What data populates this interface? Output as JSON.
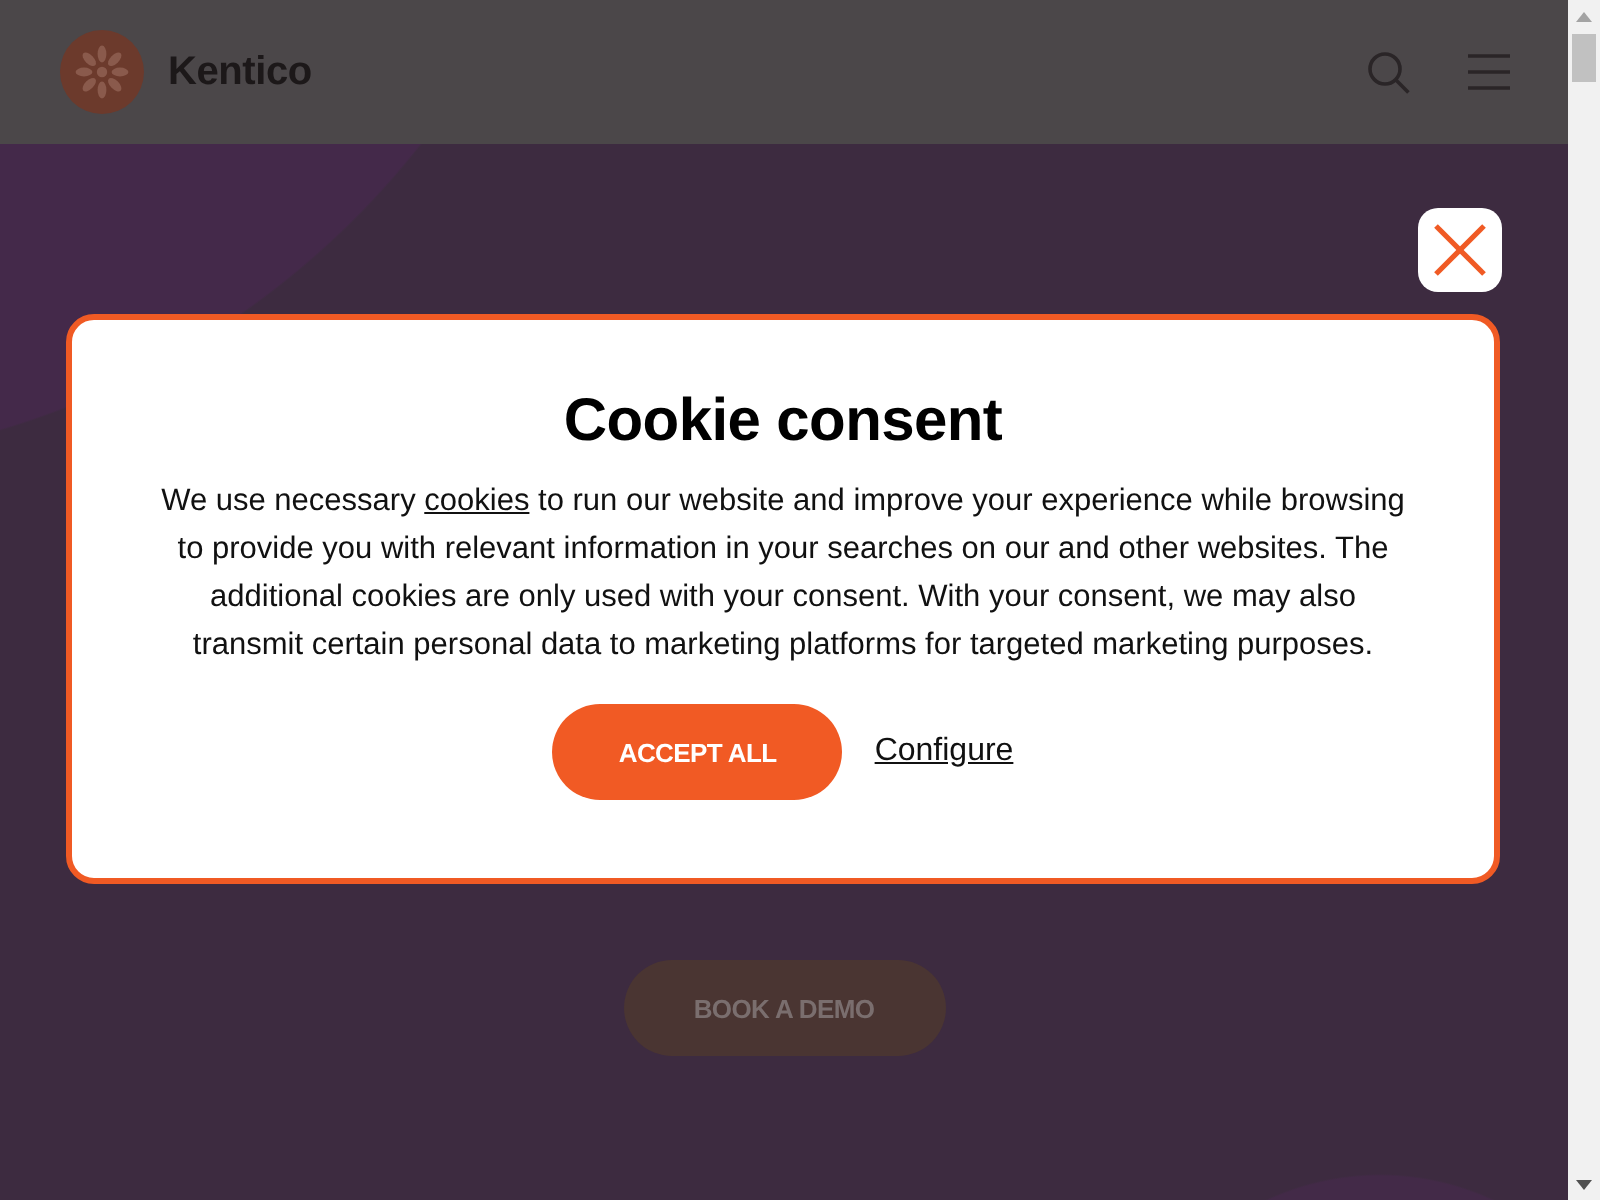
{
  "header": {
    "logo_text": "Kentico"
  },
  "hero": {
    "button": "BOOK A DEMO"
  },
  "cookie_dialog": {
    "title": "Cookie consent",
    "text_before_link": "We use necessary ",
    "link": "cookies",
    "text_after_link": " to run our website and improve your experience while browsing to provide you with relevant information in your searches on our and other websites. The additional cookies are only used with your consent. With your consent, we may also transmit certain personal data to marketing platforms for targeted marketing purposes.",
    "accept_button": "ACCEPT ALL",
    "configure_link": "Configure"
  }
}
